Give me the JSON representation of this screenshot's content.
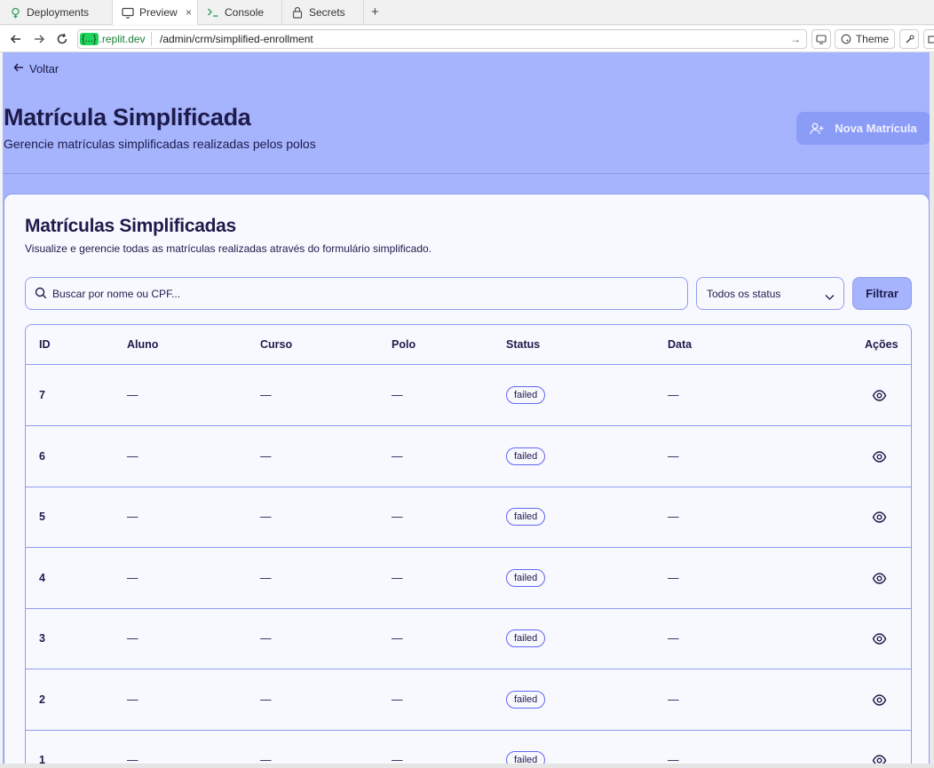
{
  "ide": {
    "tabs": [
      {
        "label": "Deployments",
        "icon": "deploy-icon"
      },
      {
        "label": "Preview",
        "icon": "monitor-icon"
      },
      {
        "label": "Console",
        "icon": "terminal-icon"
      },
      {
        "label": "Secrets",
        "icon": "lock-icon"
      }
    ],
    "new_tab": "+",
    "close": "×"
  },
  "addressbar": {
    "domain_badge": "{...}",
    "domain": ".replit.dev",
    "path": "/admin/crm/simplified-enrollment",
    "theme_label": "Theme"
  },
  "page": {
    "back_label": "Voltar",
    "title": "Matrícula Simplificada",
    "subtitle": "Gerencie matrículas simplificadas realizadas pelos polos",
    "new_button": "Nova Matrícula"
  },
  "card": {
    "title": "Matrículas Simplificadas",
    "subtitle": "Visualize e gerencie todas as matrículas realizadas através do formulário simplificado.",
    "search_placeholder": "Buscar por nome ou CPF...",
    "status_select": "Todos os status",
    "filter_button": "Filtrar"
  },
  "table": {
    "headers": {
      "id": "ID",
      "aluno": "Aluno",
      "curso": "Curso",
      "polo": "Polo",
      "status": "Status",
      "data": "Data",
      "acoes": "Ações"
    },
    "rows": [
      {
        "id": "7",
        "aluno": "—",
        "curso": "—",
        "polo": "—",
        "status": "failed",
        "data": "—"
      },
      {
        "id": "6",
        "aluno": "—",
        "curso": "—",
        "polo": "—",
        "status": "failed",
        "data": "—"
      },
      {
        "id": "5",
        "aluno": "—",
        "curso": "—",
        "polo": "—",
        "status": "failed",
        "data": "—"
      },
      {
        "id": "4",
        "aluno": "—",
        "curso": "—",
        "polo": "—",
        "status": "failed",
        "data": "—"
      },
      {
        "id": "3",
        "aluno": "—",
        "curso": "—",
        "polo": "—",
        "status": "failed",
        "data": "—"
      },
      {
        "id": "2",
        "aluno": "—",
        "curso": "—",
        "polo": "—",
        "status": "failed",
        "data": "—"
      },
      {
        "id": "1",
        "aluno": "—",
        "curso": "—",
        "polo": "—",
        "status": "failed",
        "data": "—"
      }
    ]
  },
  "colors": {
    "page_bg": "#a5b4fc",
    "card_bg": "#f8f9ff",
    "text": "#1e1b4b",
    "border": "#8f9cf0",
    "button": "#8b9cf7"
  }
}
